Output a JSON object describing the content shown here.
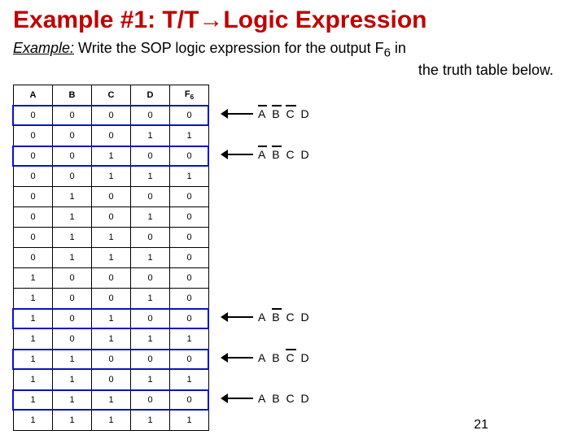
{
  "title": "Example #1: T/T→Logic Expression",
  "subtitle_lead": "Example:",
  "subtitle_rest": " Write the SOP logic expression for the output F",
  "subtitle_sub": "6",
  "subtitle_tail": " in",
  "subtitle_line2": "the truth table below.",
  "table": {
    "headers": [
      "A",
      "B",
      "C",
      "D",
      "F6"
    ],
    "rows": [
      [
        0,
        0,
        0,
        0,
        0
      ],
      [
        0,
        0,
        0,
        1,
        1
      ],
      [
        0,
        0,
        1,
        0,
        0
      ],
      [
        0,
        0,
        1,
        1,
        1
      ],
      [
        0,
        1,
        0,
        0,
        0
      ],
      [
        0,
        1,
        0,
        1,
        0
      ],
      [
        0,
        1,
        1,
        0,
        0
      ],
      [
        0,
        1,
        1,
        1,
        0
      ],
      [
        1,
        0,
        0,
        0,
        0
      ],
      [
        1,
        0,
        0,
        1,
        0
      ],
      [
        1,
        0,
        1,
        0,
        0
      ],
      [
        1,
        0,
        1,
        1,
        1
      ],
      [
        1,
        1,
        0,
        0,
        0
      ],
      [
        1,
        1,
        0,
        1,
        1
      ],
      [
        1,
        1,
        1,
        0,
        0
      ],
      [
        1,
        1,
        1,
        1,
        1
      ]
    ]
  },
  "chart_data": {
    "type": "table",
    "description": "Truth table with 4 inputs A,B,C,D and output F6; rows with F6=1 are highlighted and mapped to SOP minterms.",
    "highlighted_rows": [
      1,
      3,
      11,
      13,
      15
    ],
    "minterms": [
      {
        "row": 1,
        "A": 0,
        "B": 0,
        "C": 0,
        "D": 1,
        "bars": [
          "A",
          "B",
          "C"
        ]
      },
      {
        "row": 3,
        "A": 0,
        "B": 0,
        "C": 1,
        "D": 1,
        "bars": [
          "A",
          "B"
        ]
      },
      {
        "row": 11,
        "A": 1,
        "B": 0,
        "C": 1,
        "D": 1,
        "bars": [
          "B"
        ]
      },
      {
        "row": 13,
        "A": 1,
        "B": 1,
        "C": 0,
        "D": 1,
        "bars": [
          "C"
        ]
      },
      {
        "row": 15,
        "A": 1,
        "B": 1,
        "C": 1,
        "D": 1,
        "bars": []
      }
    ]
  },
  "terms": {
    "t1": {
      "A": "A",
      "B": "B",
      "C": "C",
      "D": "D"
    },
    "t3": {
      "A": "A",
      "B": "B",
      "C": "C",
      "D": "D"
    },
    "t11": {
      "A": "A",
      "B": "B",
      "C": "C",
      "D": "D"
    },
    "t13": {
      "A": "A",
      "B": "B",
      "C": "C",
      "D": "D"
    },
    "t15": {
      "A": "A",
      "B": "B",
      "C": "C",
      "D": "D"
    }
  },
  "page_number": "21"
}
